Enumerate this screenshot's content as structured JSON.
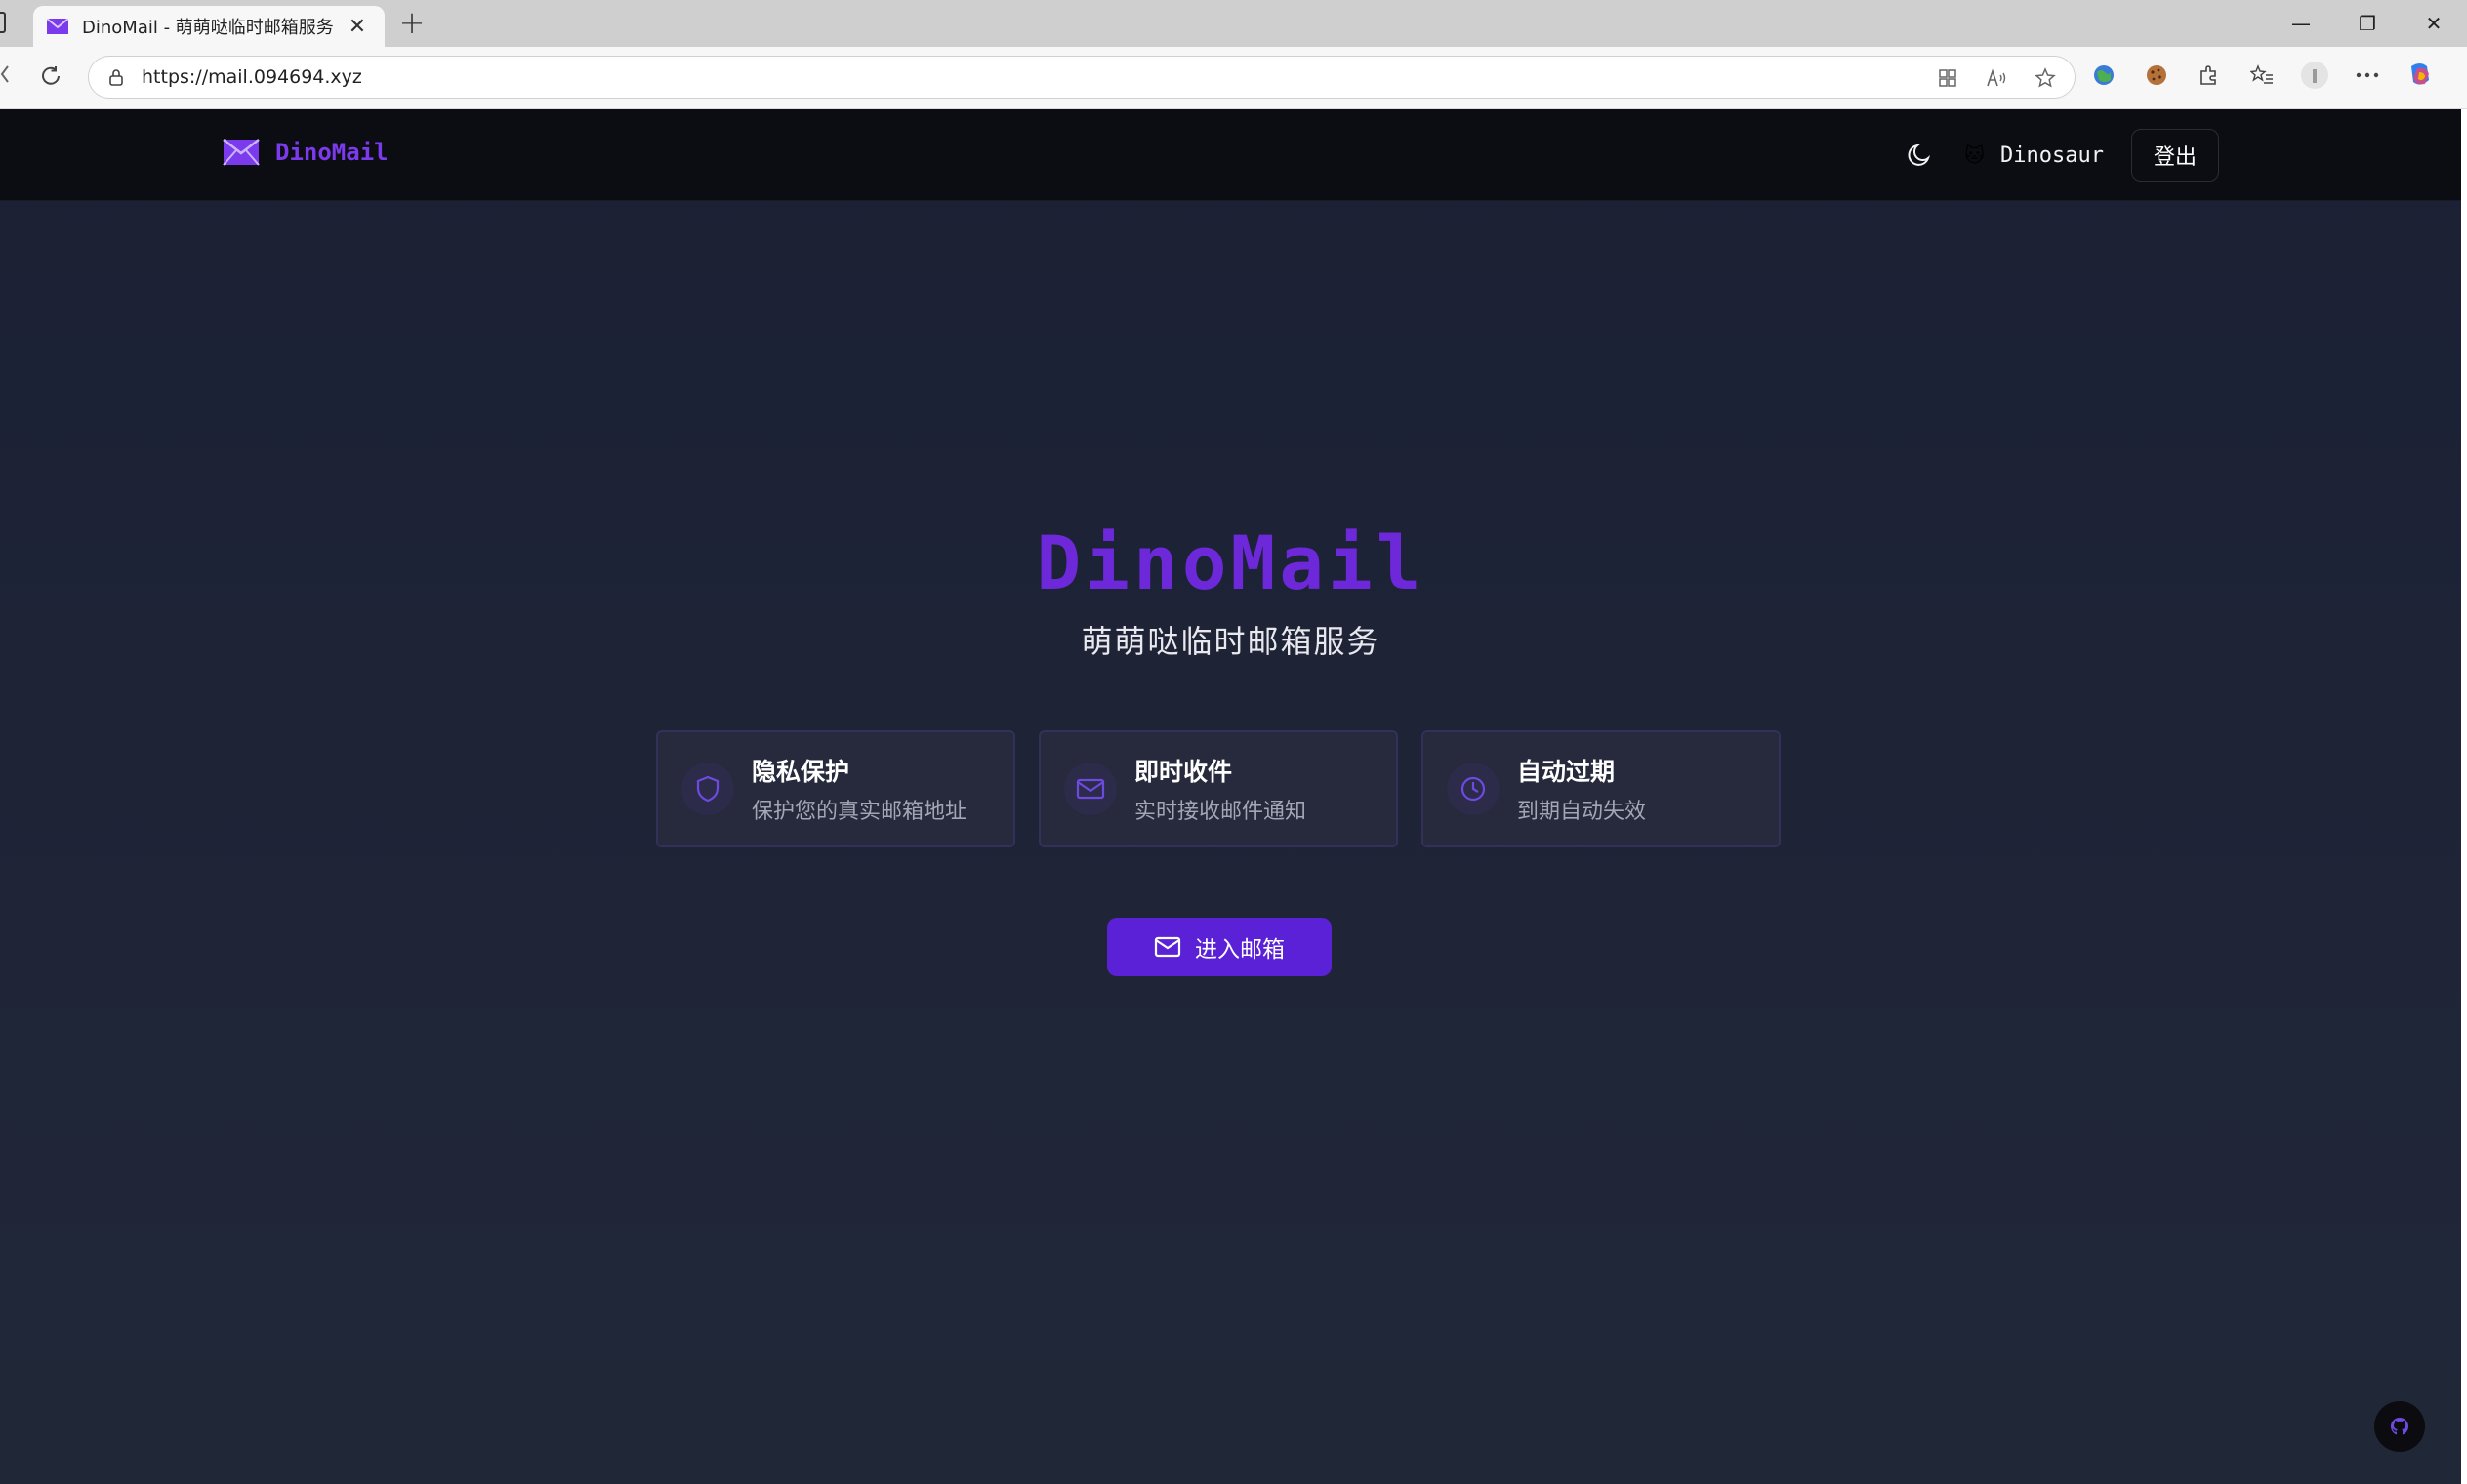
{
  "browser": {
    "tab_title": "DinoMail - 萌萌哒临时邮箱服务",
    "tab_close": "✕",
    "new_tab": "+",
    "url": "https://mail.094694.xyz",
    "window_controls": {
      "minimize": "—",
      "restore": "❐",
      "close": "✕"
    }
  },
  "header": {
    "brand": "DinoMail",
    "user_emoji": "🐱",
    "username": "Dinosaur",
    "logout_label": "登出"
  },
  "hero": {
    "title": "DinoMail",
    "subtitle": "萌萌哒临时邮箱服务"
  },
  "features": [
    {
      "icon": "shield-icon",
      "title": "隐私保护",
      "desc": "保护您的真实邮箱地址"
    },
    {
      "icon": "mail-icon",
      "title": "即时收件",
      "desc": "实时接收邮件通知"
    },
    {
      "icon": "clock-icon",
      "title": "自动过期",
      "desc": "到期自动失效"
    }
  ],
  "cta": {
    "label": "进入邮箱"
  },
  "colors": {
    "accent": "#6d28d9",
    "button": "#5b21d6",
    "header_bg": "#0c0d12",
    "page_bg": "#1e2433"
  }
}
